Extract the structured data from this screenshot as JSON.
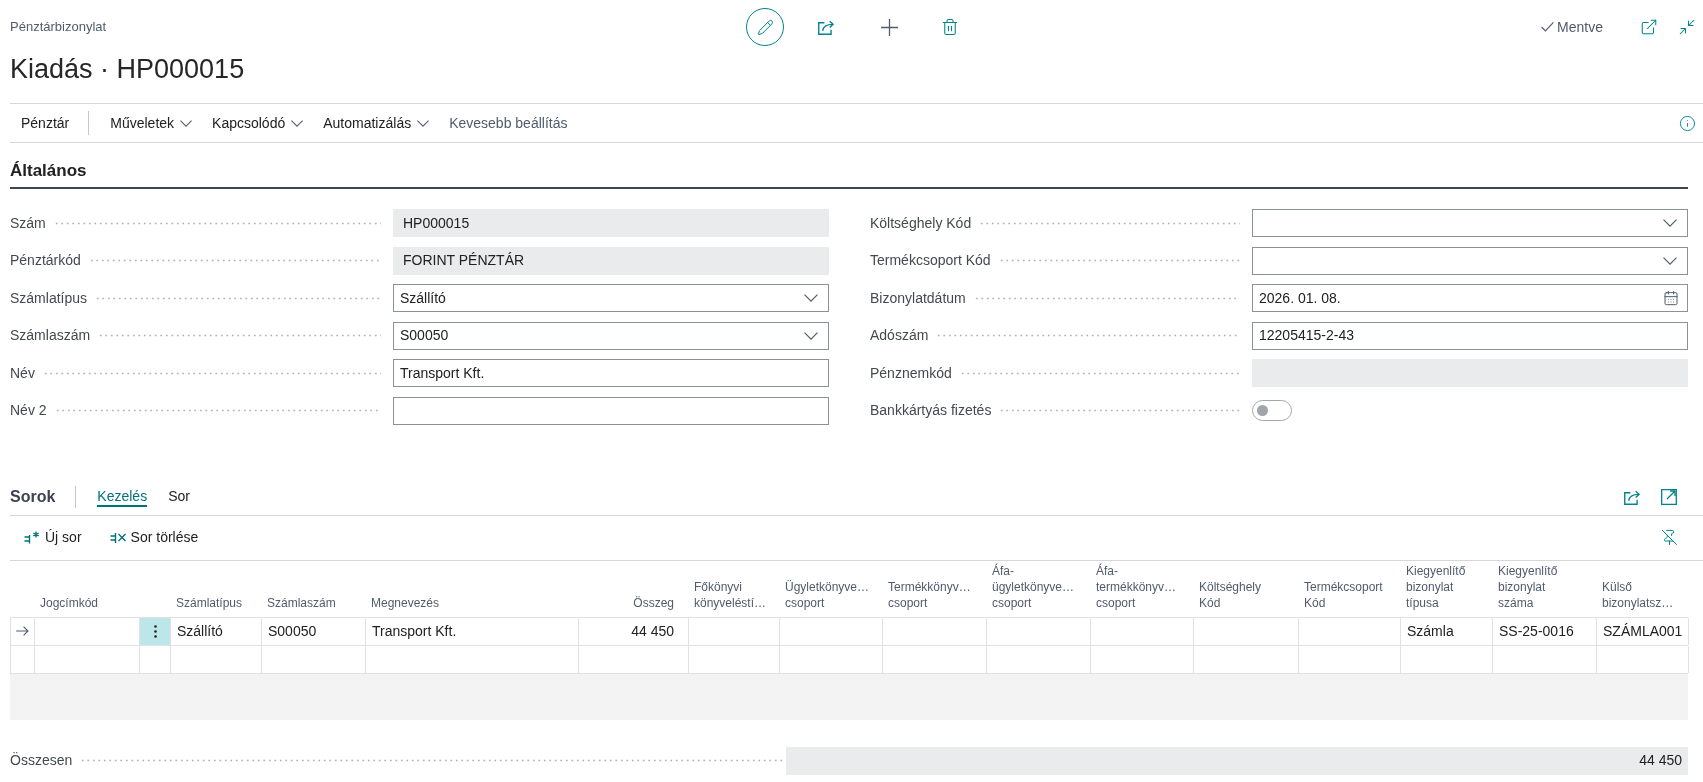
{
  "page": {
    "caption": "Pénztárbizonylat",
    "title": "Kiadás · HP000015",
    "status": "Mentve"
  },
  "action_bar": [
    {
      "label": "Pénztár",
      "kind": "button"
    },
    {
      "label": "Műveletek",
      "kind": "menu"
    },
    {
      "label": "Kapcsolódó",
      "kind": "menu"
    },
    {
      "label": "Automatizálás",
      "kind": "menu"
    },
    {
      "label": "Kevesebb beállítás",
      "kind": "link"
    }
  ],
  "general": {
    "title": "Általános",
    "left": [
      {
        "label": "Szám",
        "kind": "readonly",
        "value": "HP000015"
      },
      {
        "label": "Pénztárkód",
        "kind": "readonly",
        "value": "FORINT PÉNZTÁR"
      },
      {
        "label": "Számlatípus",
        "kind": "dropdown",
        "value": "Szállító"
      },
      {
        "label": "Számlaszám",
        "kind": "dropdown",
        "value": "S00050"
      },
      {
        "label": "Név",
        "kind": "text",
        "value": "Transport Kft."
      },
      {
        "label": "Név 2",
        "kind": "text"
      }
    ],
    "right": [
      {
        "label": "Költséghely Kód",
        "kind": "dropdown"
      },
      {
        "label": "Termékcsoport Kód",
        "kind": "dropdown"
      },
      {
        "label": "Bizonylatdátum",
        "kind": "date",
        "value": "2026. 01. 08."
      },
      {
        "label": "Adószám",
        "kind": "text",
        "value": "12205415-2-43"
      },
      {
        "label": "Pénznemkód",
        "kind": "readonly"
      },
      {
        "label": "Bankkártyás fizetés",
        "kind": "toggle",
        "on": false
      }
    ]
  },
  "lines": {
    "title": "Sorok",
    "tabs": [
      {
        "label": "Kezelés",
        "selected": true
      },
      {
        "label": "Sor",
        "selected": false
      }
    ],
    "actions": [
      {
        "label": "Új sor",
        "kind": "new"
      },
      {
        "label": "Sor törlése",
        "kind": "delete"
      }
    ],
    "table": {
      "columns": [
        {
          "label": "Jogcímkód"
        },
        {
          "label": "Számlatípus"
        },
        {
          "label": "Számlaszám"
        },
        {
          "label": "Megnevezés"
        },
        {
          "label": "Összeg"
        },
        {
          "label": "Főkönyvi\nkönyveléstí…"
        },
        {
          "label": "Ügyletkönyve…\ncsoport"
        },
        {
          "label": "Termékkönyv…\ncsoport"
        },
        {
          "label": "Áfa-\nügyletkönyve…\ncsoport"
        },
        {
          "label": "Áfa-\ntermékkönyv…\ncsoport"
        },
        {
          "label": "Költséghely\nKód"
        },
        {
          "label": "Termékcsoport\nKód"
        },
        {
          "label": "Kiegyenlítő\nbizonylat\ntípusa"
        },
        {
          "label": "Kiegyenlítő\nbizonylat\nszáma"
        },
        {
          "label": "Külső\nbizonylatsz…"
        }
      ],
      "rows": [
        {
          "selected": true,
          "account_type": "Szállító",
          "account_no": "S00050",
          "description": "Transport Kft.",
          "amount": "44 450",
          "applies_to_doc_type": "Számla",
          "applies_to_doc_no": "SS-25-0016",
          "external_doc_no": "SZÁMLA001"
        },
        {
          "selected": false
        }
      ]
    }
  },
  "total": {
    "label": "Összesen",
    "value": "44 450"
  }
}
